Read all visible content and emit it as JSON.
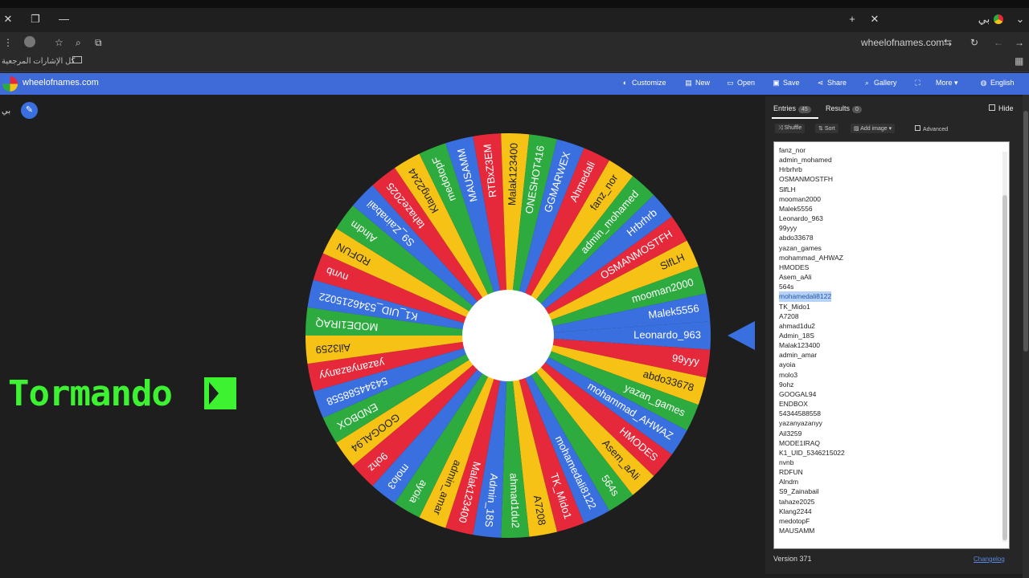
{
  "browser": {
    "tab_title": "بي",
    "window_close": "✕",
    "window_restore": "❐",
    "window_minimize": "—",
    "new_tab": "+",
    "tab_close": "✕",
    "tab_menu": "⌄",
    "url": "wheelofnames.com",
    "bookmarks_label": "كل الإشارات المرجعية"
  },
  "app": {
    "site_name": "wheelofnames.com",
    "nav": [
      "Customize",
      "New",
      "Open",
      "Save",
      "Share",
      "Gallery",
      "Fullscreen",
      "More",
      "English"
    ],
    "user_label": "بي"
  },
  "overlay": {
    "text": "Tormando"
  },
  "panel": {
    "tab_entries": "Entries",
    "entries_count": "45",
    "tab_results": "Results",
    "results_count": "0",
    "hide_label": "Hide",
    "tools": [
      "Shuffle",
      "Sort",
      "Add image",
      "Advanced"
    ],
    "entries": [
      "fanz_nor",
      "admin_mohamed",
      "Hrbrhrb",
      "OSMANMOSTFH",
      "SlfLH",
      "mooman2000",
      "Malek5556",
      "Leonardo_963",
      "99yyy",
      "abdo33678",
      "yazan_games",
      "mohammad_AHWAZ",
      "HMODES",
      "Asem_aAli",
      "564s",
      "mohamedali8122",
      "TK_Mido1",
      "A7208",
      "ahmad1du2",
      "Admin_18S",
      "Malak123400",
      "admin_amar",
      "ayoia",
      "molo3",
      "9ohz",
      "GOOGAL94",
      "ENDBOX",
      "54344588558",
      "yazanyazanyy",
      "Ail3259",
      "MODE1IRAQ",
      "K1_UID_5346215022",
      "nvnb",
      "RDFUN",
      "Alndm",
      "S9_Zainabail",
      "tahaze2025",
      "Klang2244",
      "medotopF",
      "MAUSAMM"
    ],
    "selected_entry": "mohamedali8122",
    "version": "Version 371",
    "changelog": "Changelog"
  },
  "wheel": {
    "segments": [
      "Leonardo_963",
      "99yyy",
      "abdo33678",
      "yazan_games",
      "mohammad_AHWAZ",
      "HMODES",
      "Asem_aAli",
      "564s",
      "mohamedali8122",
      "TK_Mido1",
      "A7208",
      "ahmad1du2",
      "Admin_18S",
      "Malak123400",
      "admin_amar",
      "ayoia",
      "molo3",
      "9ohz",
      "GOOGAL94",
      "ENDBOX",
      "54344588558",
      "yazanyazanyy",
      "Ail3259",
      "MODE1IRAQ",
      "K1_UID_5346215022",
      "nvnb",
      "RDFUN",
      "Alndm",
      "S9_Zainabail",
      "tahaze2025",
      "Klang2244",
      "medotopF",
      "MAUSAMM",
      "RTBxZ3EM",
      "Malak123400",
      "ONESHOT416",
      "GGMARWEX",
      "Ahmedali",
      "fanz_nor",
      "admin_mohamed",
      "Hrbrhrb",
      "OSMANMOSTFH",
      "SlfLH",
      "mooman2000",
      "Malek5556"
    ],
    "colors": [
      "#3a6fe0",
      "#e5283a",
      "#f6c215",
      "#2dab3e"
    ]
  }
}
